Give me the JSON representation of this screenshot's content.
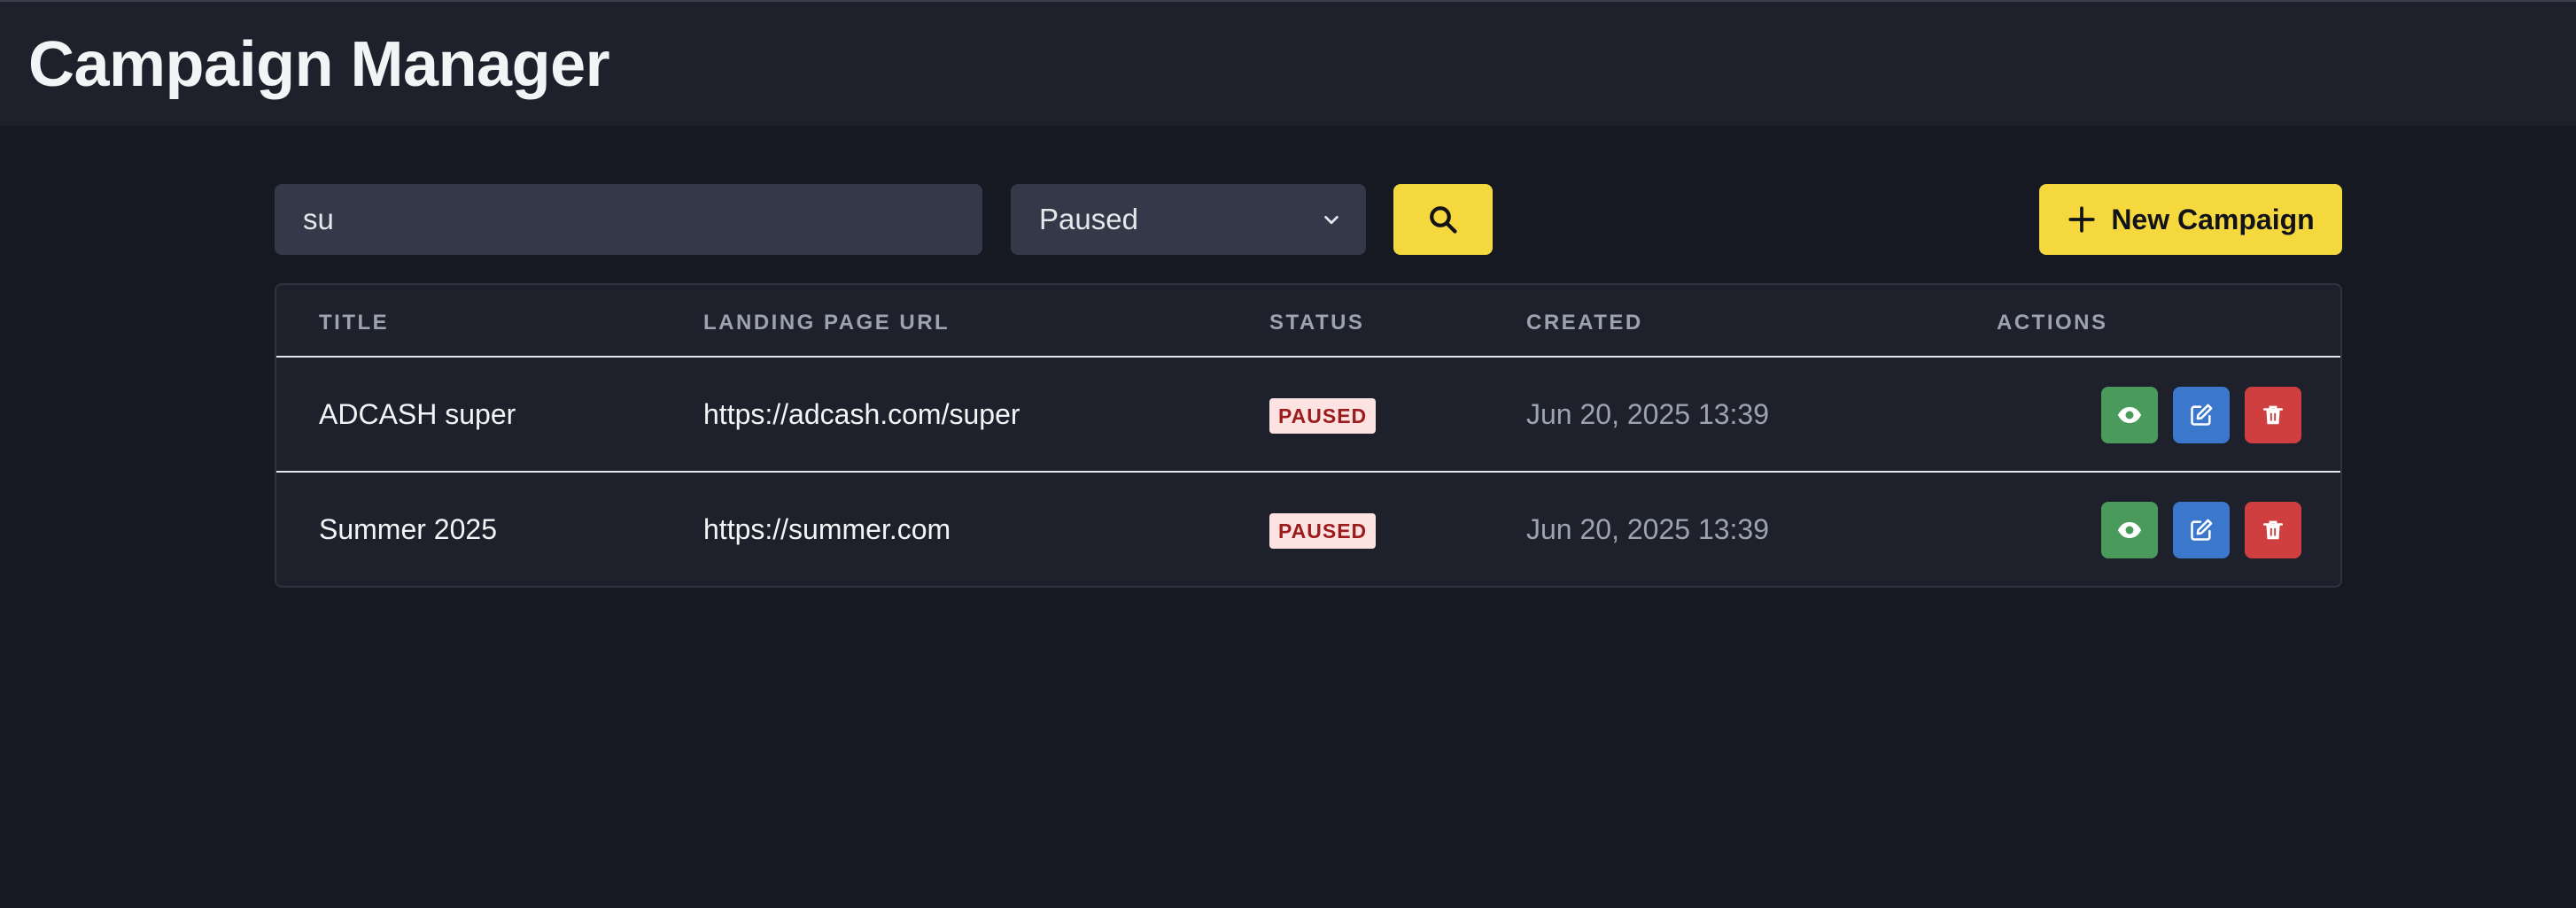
{
  "app": {
    "title": "Campaign Manager"
  },
  "filters": {
    "search_value": "su",
    "status_selected": "Paused",
    "search_icon": "search-icon",
    "new_campaign_label": "New Campaign",
    "new_campaign_icon": "plus-icon",
    "accent_color": "#f5d73e"
  },
  "table": {
    "columns": [
      "TITLE",
      "LANDING PAGE URL",
      "STATUS",
      "CREATED",
      "ACTIONS"
    ],
    "rows": [
      {
        "title": "ADCASH super",
        "url": "https://adcash.com/super",
        "status": "PAUSED",
        "created": "Jun 20, 2025 13:39"
      },
      {
        "title": "Summer 2025",
        "url": "https://summer.com",
        "status": "PAUSED",
        "created": "Jun 20, 2025 13:39"
      }
    ],
    "actions": [
      {
        "icon": "eye-icon",
        "color": "#4a9a5c"
      },
      {
        "icon": "edit-icon",
        "color": "#3b78cc"
      },
      {
        "icon": "trash-icon",
        "color": "#cf3f3f"
      }
    ]
  }
}
